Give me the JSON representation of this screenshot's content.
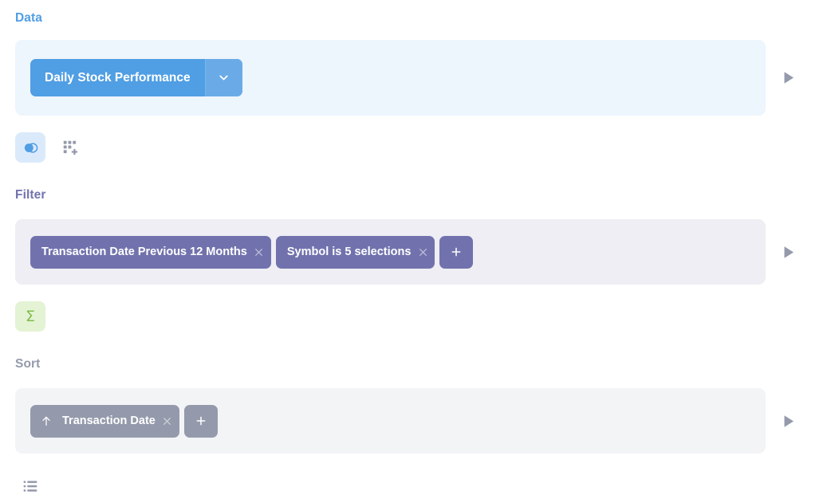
{
  "notebook": {
    "sections": [
      {
        "id": "data",
        "header": "Data",
        "accent": "#509ee3",
        "table": {
          "name": "Daily Stock Performance",
          "caret_icon": "chevron-down-icon"
        },
        "actions": [
          {
            "id": "join",
            "icon": "join-data-icon",
            "tooltip": "Join data",
            "active": true
          },
          {
            "id": "custom-col",
            "icon": "add-column-icon",
            "tooltip": "Custom column",
            "active": false
          }
        ],
        "preview_icon": "play-icon"
      },
      {
        "id": "filter",
        "header": "Filter",
        "accent": "#7172ad",
        "chips": [
          {
            "label": "Transaction Date Previous 12 Months",
            "remove_icon": "close-icon"
          },
          {
            "label": "Symbol is 5 selections",
            "remove_icon": "close-icon"
          }
        ],
        "add_label": "+",
        "add_icon": "plus-icon",
        "actions": [
          {
            "id": "summarize",
            "icon": "sigma-icon",
            "glyph": "Σ",
            "tooltip": "Summarize",
            "active": true
          }
        ],
        "preview_icon": "play-icon"
      },
      {
        "id": "sort",
        "header": "Sort",
        "accent": "#949aab",
        "chips": [
          {
            "label": "Transaction Date",
            "direction_icon": "arrow-up-icon",
            "direction": "ascending",
            "remove_icon": "close-icon"
          }
        ],
        "add_label": "+",
        "add_icon": "plus-icon",
        "actions": [
          {
            "id": "row-limit",
            "icon": "row-limit-icon",
            "tooltip": "Row limit",
            "active": false
          }
        ],
        "preview_icon": "play-icon"
      }
    ]
  },
  "colors": {
    "data_accent": "#509ee3",
    "data_panel_bg": "#edf5fd",
    "filter_accent": "#7172ad",
    "filter_panel_bg": "#eeeef4",
    "sort_accent": "#949aab",
    "sort_panel_bg": "#f3f4f6",
    "summarize_accent": "#84bb4c",
    "icon_gray": "#949aab"
  }
}
